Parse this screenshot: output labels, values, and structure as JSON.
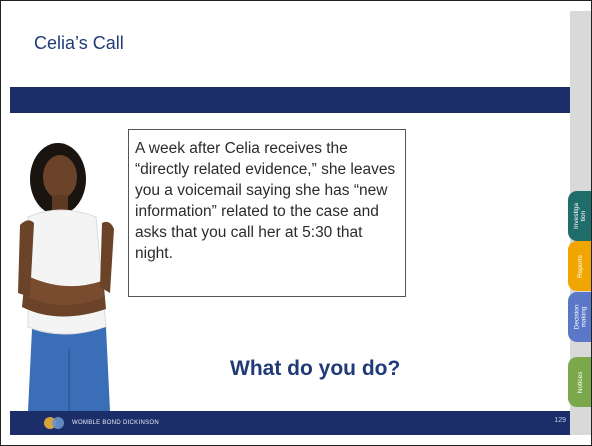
{
  "slide": {
    "title": "Celia’s Call",
    "body": "A week after Celia receives the “directly related evidence,” she leaves you a voicemail saying she has “new information” related to the case and asks that you call her at 5:30 that night.",
    "question": "What do you do?",
    "page_number": "129"
  },
  "footer": {
    "brand": "WOMBLE BOND DICKINSON"
  },
  "side_tabs": [
    {
      "label": "Investiga tion",
      "color": "#1f6d6b"
    },
    {
      "label": "Reports",
      "color": "#f0a500"
    },
    {
      "label": "Decision making",
      "color": "#5b78c8"
    },
    {
      "label": "Notices",
      "color": "#7aa84a"
    }
  ],
  "colors": {
    "title": "#1f3a77",
    "band": "#1b2e6a",
    "right_bar": "#d9d9d9"
  },
  "icons": {
    "figure": "woman-arms-crossed-illustration",
    "logo": "womble-bond-dickinson-logo"
  }
}
